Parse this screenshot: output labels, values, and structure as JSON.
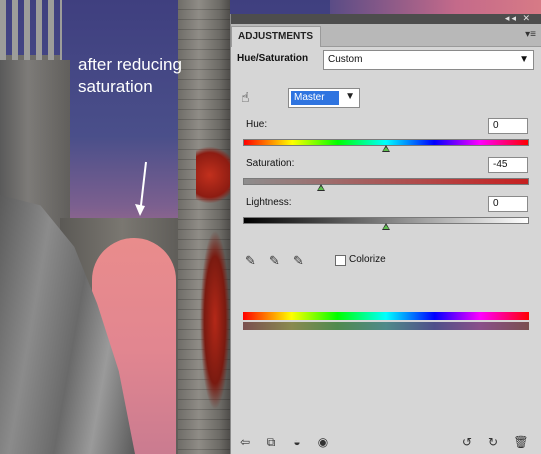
{
  "annotation": {
    "line1": "after reducing",
    "line2": "saturation"
  },
  "panel": {
    "tab_label": "ADJUSTMENTS",
    "header_label": "Hue/Saturation",
    "preset_value": "Custom",
    "channel_value": "Master",
    "hue": {
      "label": "Hue:",
      "value": "0",
      "position": 0.5
    },
    "saturation": {
      "label": "Saturation:",
      "value": "-45",
      "position": 0.275
    },
    "lightness": {
      "label": "Lightness:",
      "value": "0",
      "position": 0.5
    },
    "colorize_label": "Colorize",
    "colorize_checked": false
  },
  "icons": {
    "targeted_adjustment": "hand-icon",
    "eyedroppers": [
      "eyedropper-icon",
      "eyedropper-plus-icon",
      "eyedropper-minus-icon"
    ],
    "bottom_left": [
      "back-arrow-icon",
      "clip-to-layer-icon",
      "visibility-toggle-icon",
      "eye-icon"
    ],
    "bottom_right": [
      "view-previous-icon",
      "reset-icon",
      "trash-icon"
    ]
  },
  "colors": {
    "channel_highlight": "#2f74e0",
    "thumb_fill": "#5fbf4f",
    "annotation_text": "#ffffff"
  }
}
